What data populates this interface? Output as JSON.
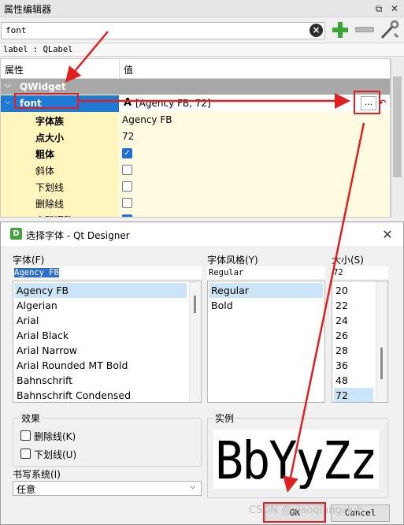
{
  "property_editor": {
    "title": "属性编辑器",
    "titlebar_buttons": {
      "float": "⧉",
      "close": "✕"
    },
    "filter": {
      "value": "font",
      "clear_icon": "clear-icon"
    },
    "toolbar": {
      "add_icon": "add-icon",
      "remove_icon": "remove-icon",
      "configure_icon": "wrench-icon"
    },
    "object_info": "label : QLabel",
    "headers": {
      "property": "属性",
      "value": "值"
    },
    "group": {
      "expander": "⌵",
      "name": "QWidget"
    },
    "font_row": {
      "expander": "⌵",
      "label": "font",
      "glyph": "A",
      "value": "[Agency FB, 72]",
      "browse_label": "...",
      "reset_icon": "reset-arrow-icon"
    },
    "sub_properties": [
      {
        "label": "字体族",
        "value": "Agency FB",
        "type": "text"
      },
      {
        "label": "点大小",
        "value": "72",
        "type": "text"
      },
      {
        "label": "粗体",
        "type": "check",
        "checked": true
      },
      {
        "label": "斜体",
        "type": "check",
        "checked": false
      },
      {
        "label": "下划线",
        "type": "check",
        "checked": false
      },
      {
        "label": "删除线",
        "type": "check",
        "checked": false
      },
      {
        "label": "字距调整",
        "type": "check",
        "checked": true
      }
    ]
  },
  "font_dialog": {
    "icon_letter": "D",
    "title": "选择字体 - Qt Designer",
    "close_label": "✕",
    "family": {
      "label": "字体(F)",
      "current": "Agency FB",
      "items": [
        "Agency FB",
        "Algerian",
        "Arial",
        "Arial Black",
        "Arial Narrow",
        "Arial Rounded MT Bold",
        "Bahnschrift",
        "Bahnschrift Condensed"
      ],
      "selected_index": 0
    },
    "style": {
      "label": "字体风格(Y)",
      "current": "Regular",
      "items": [
        "Regular",
        "Bold"
      ],
      "selected_index": 0
    },
    "size": {
      "label": "大小(S)",
      "current": "72",
      "items": [
        "20",
        "22",
        "24",
        "26",
        "28",
        "36",
        "48",
        "72"
      ],
      "selected_index": 7
    },
    "effects": {
      "label": "效果",
      "strikeout": "删除线(K)",
      "underline": "下划线(U)"
    },
    "sample": {
      "label": "实例",
      "text": "BbYyZz"
    },
    "writing_system": {
      "label": "书写系统(I)",
      "value": "任意",
      "arrow": "⌵"
    },
    "ok_label": "OK",
    "cancel_label": "Cancel"
  },
  "watermark": "CSDN @xiaoqiangclub",
  "annotation_color": "#e02020"
}
